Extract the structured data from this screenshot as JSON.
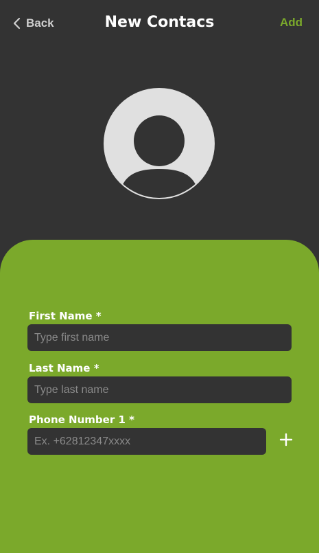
{
  "header": {
    "back_label": "Back",
    "title": "New Contacs",
    "add_label": "Add"
  },
  "form": {
    "first_name": {
      "label": "First Name *",
      "placeholder": "Type first name",
      "value": ""
    },
    "last_name": {
      "label": "Last Name *",
      "placeholder": "Type last name",
      "value": ""
    },
    "phone": {
      "label": "Phone Number 1 *",
      "placeholder": "Ex. +62812347xxxx",
      "value": ""
    }
  },
  "icons": {
    "back": "chevron-left-icon",
    "avatar": "user-avatar-icon",
    "add_phone": "plus-icon"
  },
  "colors": {
    "background": "#333333",
    "accent": "#7ba92b",
    "avatar": "#e0e0e0",
    "text": "#ffffff"
  }
}
